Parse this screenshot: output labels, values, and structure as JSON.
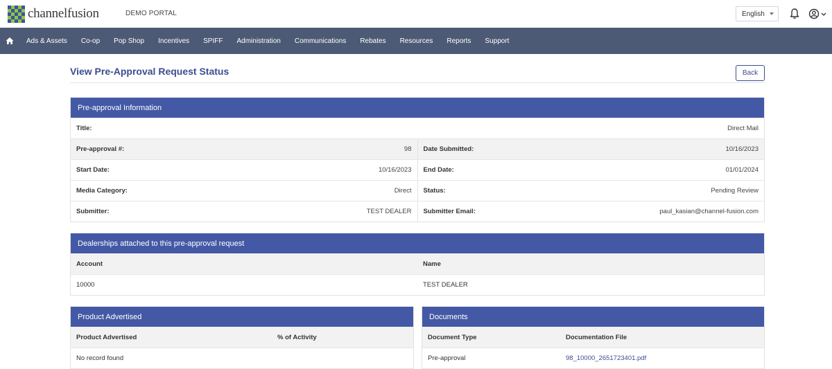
{
  "header": {
    "logo_text": "channelfusion",
    "portal_name": "DEMO PORTAL",
    "language": "English"
  },
  "nav": {
    "items": [
      "Ads & Assets",
      "Co-op",
      "Pop Shop",
      "Incentives",
      "SPIFF",
      "Administration",
      "Communications",
      "Rebates",
      "Resources",
      "Reports",
      "Support"
    ]
  },
  "page": {
    "title": "View Pre-Approval Request Status",
    "back_label": "Back"
  },
  "preapproval": {
    "heading": "Pre-approval Information",
    "title_label": "Title:",
    "title_value": "Direct Mail",
    "number_label": "Pre-approval #:",
    "number_value": "98",
    "date_submitted_label": "Date Submitted:",
    "date_submitted_value": "10/16/2023",
    "start_date_label": "Start Date:",
    "start_date_value": "10/16/2023",
    "end_date_label": "End Date:",
    "end_date_value": "01/01/2024",
    "media_category_label": "Media Category:",
    "media_category_value": "Direct",
    "status_label": "Status:",
    "status_value": "Pending Review",
    "submitter_label": "Submitter:",
    "submitter_value": "TEST DEALER",
    "submitter_email_label": "Submitter Email:",
    "submitter_email_value": "paul_kasian@channel-fusion.com"
  },
  "dealerships": {
    "heading": "Dealerships attached to this pre-approval request",
    "columns": [
      "Account",
      "Name"
    ],
    "rows": [
      [
        "10000",
        "TEST DEALER"
      ]
    ]
  },
  "product": {
    "heading": "Product Advertised",
    "columns": [
      "Product Advertised",
      "% of Activity"
    ],
    "empty_text": "No record found"
  },
  "documents": {
    "heading": "Documents",
    "columns": [
      "Document Type",
      "Documentation File"
    ],
    "rows": [
      [
        "Pre-approval",
        "98_10000_2651723401.pdf"
      ]
    ]
  },
  "colors": {
    "nav_bg": "#4d5a75",
    "panel_head": "#4459a5",
    "accent": "#3b4d8f"
  }
}
